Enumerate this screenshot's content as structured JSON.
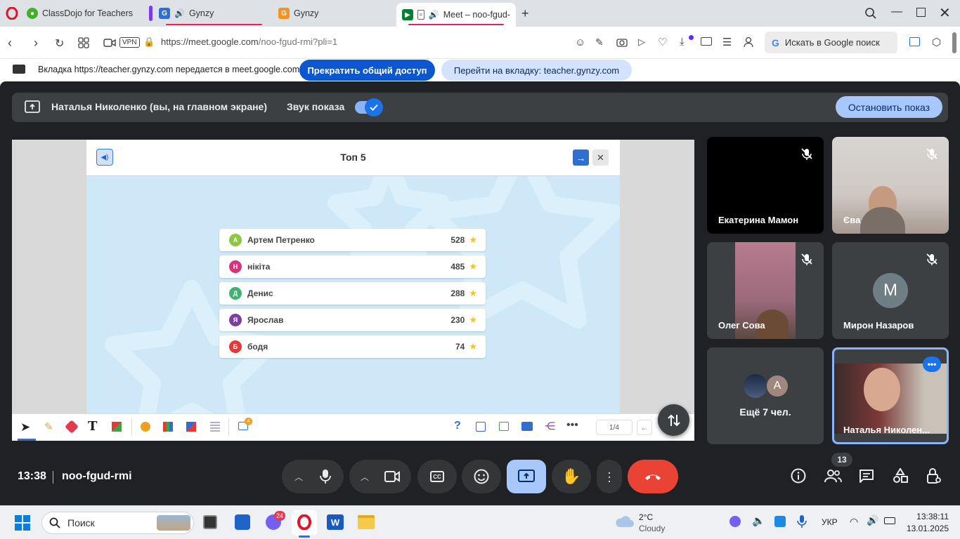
{
  "browser": {
    "tabs": [
      {
        "title": "ClassDojo for Teachers"
      },
      {
        "title": "Gynzy"
      },
      {
        "title": "Gynzy"
      },
      {
        "title": "Meet – noo-fgud-r"
      }
    ],
    "url": "https://meet.google.com/noo-fgud-rmi?pli=1",
    "url_host": "https://meet.google.com",
    "url_path": "/noo-fgud-rmi?pli=1",
    "vpn_label": "VPN",
    "search_placeholder": "Искать в Google поиск"
  },
  "sharebar": {
    "text": "Вкладка https://teacher.gynzy.com передается в meet.google.com",
    "stop_sharing": "Прекратить общий доступ",
    "goto_tab": "Перейти на вкладку: teacher.gynzy.com"
  },
  "meet": {
    "presenter_label": "Наталья Николенко (вы, на главном экране)",
    "sound_label": "Звук показа",
    "stop_presenting": "Остановить показ",
    "time": "13:38",
    "meeting_code": "noo-fgud-rmi",
    "people_count": "13",
    "participants": [
      {
        "name": "Екатерина Мамон",
        "muted": true
      },
      {
        "name": "Єва",
        "muted": true
      },
      {
        "name": "Олег Сова",
        "muted": true
      },
      {
        "name": "Мирон Назаров",
        "initial": "M",
        "muted": true
      },
      {
        "name": "Ещё 7 чел.",
        "initial": "A"
      },
      {
        "name": "Наталья Николен..."
      }
    ]
  },
  "gynzy": {
    "title": "Топ 5",
    "leaders": [
      {
        "initial": "А",
        "name": "Артем Петренко",
        "score": "528",
        "color": "#8dc63f"
      },
      {
        "initial": "Н",
        "name": "нікіта",
        "score": "485",
        "color": "#d6337a"
      },
      {
        "initial": "Д",
        "name": "Денис",
        "score": "288",
        "color": "#3cb371"
      },
      {
        "initial": "Я",
        "name": "Ярослав",
        "score": "230",
        "color": "#7b3fa0"
      },
      {
        "initial": "Б",
        "name": "бодя",
        "score": "74",
        "color": "#e53935"
      }
    ],
    "page_indicator": "1/4",
    "notif_badge": "4"
  },
  "taskbar": {
    "search_placeholder": "Поиск",
    "viber_badge": "24",
    "weather_temp": "2°C",
    "weather_desc": "Cloudy",
    "lang": "УКР",
    "clock_time": "13:38:11",
    "clock_date": "13.01.2025"
  }
}
